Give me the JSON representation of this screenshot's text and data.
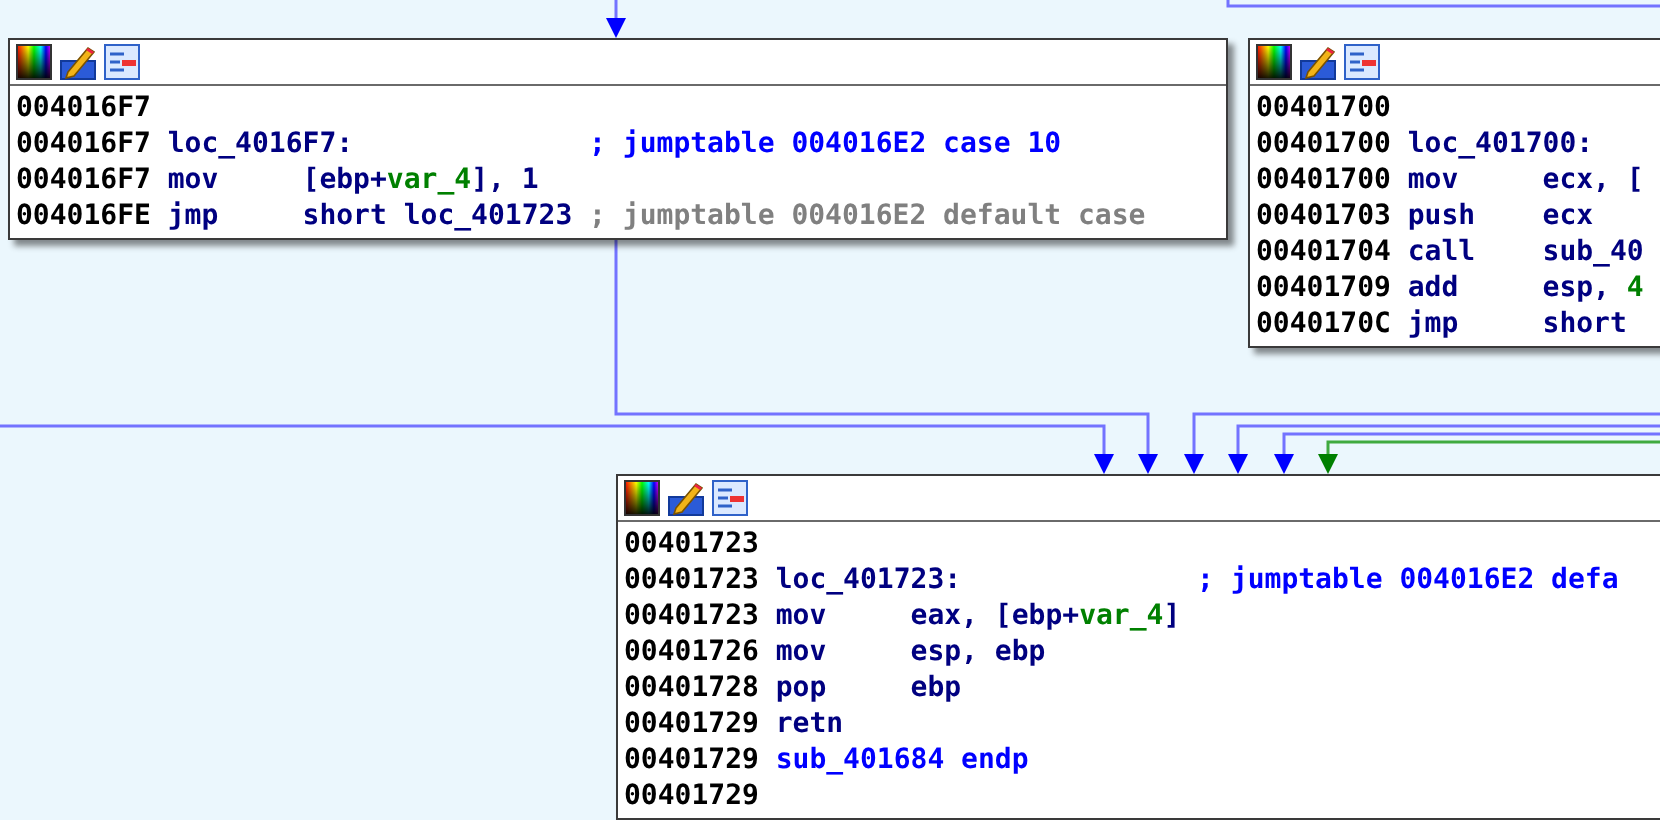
{
  "nodes": [
    {
      "lines": [
        {
          "kind": "blank",
          "address": "004016F7"
        },
        {
          "kind": "label",
          "address": "004016F7",
          "label": "loc_4016F7:",
          "comment": {
            "text": "; jumptable 004016E2 case 10",
            "kind": "xref"
          }
        },
        {
          "kind": "instr",
          "address": "004016F7",
          "mnemonic": "mov",
          "operands": [
            {
              "text": "[ebp+",
              "kind": "code"
            },
            {
              "text": "var_4",
              "kind": "name"
            },
            {
              "text": "], 1",
              "kind": "code"
            }
          ]
        },
        {
          "kind": "instr",
          "address": "004016FE",
          "mnemonic": "jmp",
          "operands": [
            {
              "text": "short loc_401723",
              "kind": "code"
            }
          ],
          "comment": {
            "text": "; jumptable 004016E2 default case",
            "kind": "auto"
          }
        }
      ]
    },
    {
      "lines": [
        {
          "kind": "blank",
          "address": "00401700"
        },
        {
          "kind": "label",
          "address": "00401700",
          "label": "loc_401700:"
        },
        {
          "kind": "instr",
          "address": "00401700",
          "mnemonic": "mov",
          "operands": [
            {
              "text": "ecx, [",
              "kind": "code"
            }
          ]
        },
        {
          "kind": "instr",
          "address": "00401703",
          "mnemonic": "push",
          "operands": [
            {
              "text": "ecx",
              "kind": "code"
            }
          ]
        },
        {
          "kind": "instr",
          "address": "00401704",
          "mnemonic": "call",
          "operands": [
            {
              "text": "sub_40",
              "kind": "code"
            }
          ]
        },
        {
          "kind": "instr",
          "address": "00401709",
          "mnemonic": "add",
          "operands": [
            {
              "text": "esp, ",
              "kind": "code"
            },
            {
              "text": "4",
              "kind": "name"
            }
          ]
        },
        {
          "kind": "instr",
          "address": "0040170C",
          "mnemonic": "jmp",
          "operands": [
            {
              "text": "short",
              "kind": "code"
            }
          ]
        }
      ]
    },
    {
      "lines": [
        {
          "kind": "blank",
          "address": "00401723"
        },
        {
          "kind": "label",
          "address": "00401723",
          "label": "loc_401723:",
          "comment": {
            "text": "; jumptable 004016E2 defa",
            "kind": "xref"
          }
        },
        {
          "kind": "instr",
          "address": "00401723",
          "mnemonic": "mov",
          "operands": [
            {
              "text": "eax, [ebp+",
              "kind": "code"
            },
            {
              "text": "var_4",
              "kind": "name"
            },
            {
              "text": "]",
              "kind": "code"
            }
          ]
        },
        {
          "kind": "instr",
          "address": "00401726",
          "mnemonic": "mov",
          "operands": [
            {
              "text": "esp, ebp",
              "kind": "code"
            }
          ]
        },
        {
          "kind": "instr",
          "address": "00401728",
          "mnemonic": "pop",
          "operands": [
            {
              "text": "ebp",
              "kind": "code"
            }
          ]
        },
        {
          "kind": "instr",
          "address": "00401729",
          "mnemonic": "retn"
        },
        {
          "kind": "func_end",
          "address": "00401729",
          "label": "sub_401684 endp"
        },
        {
          "kind": "blank",
          "address": "00401729"
        }
      ]
    }
  ]
}
